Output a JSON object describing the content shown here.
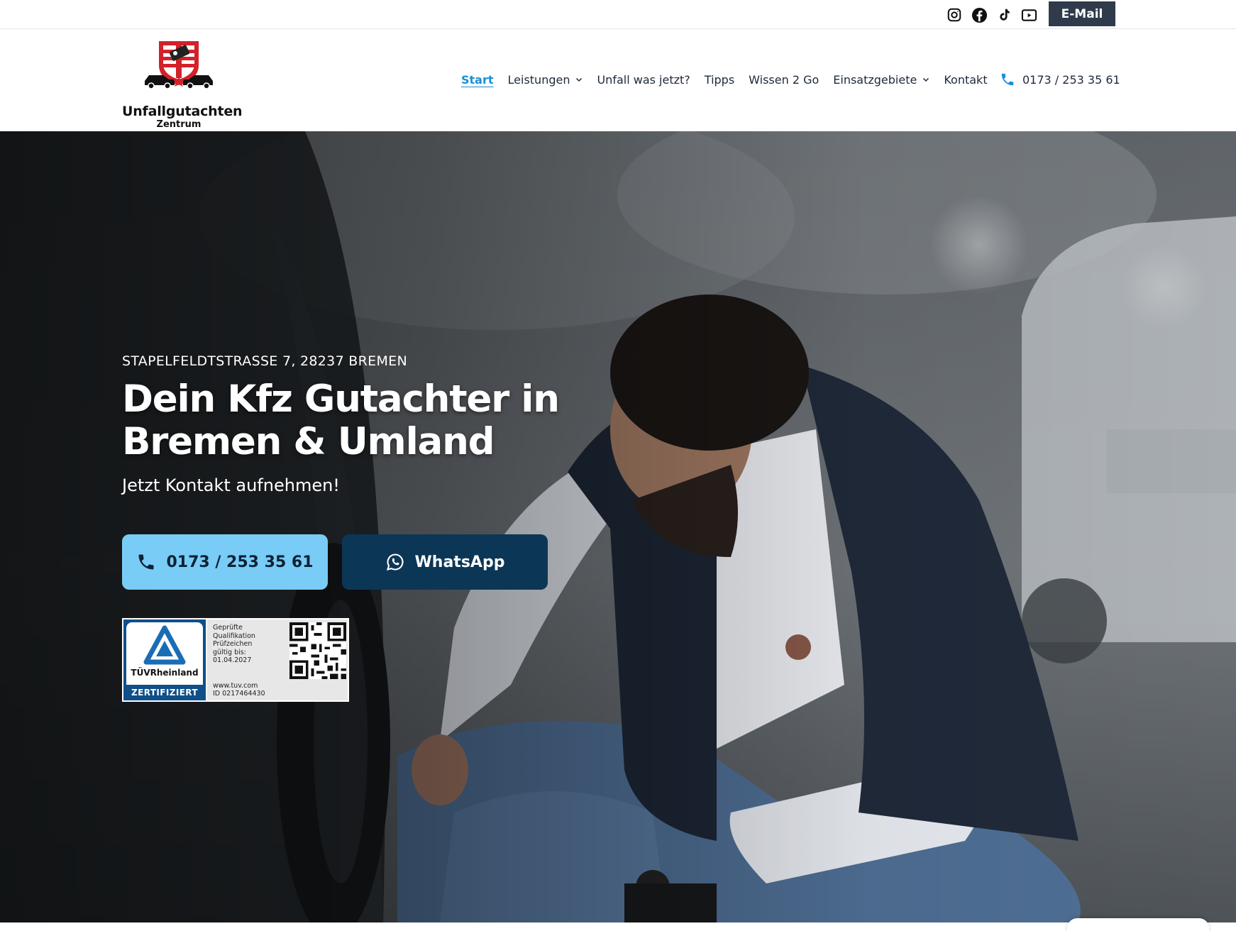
{
  "topbar": {
    "social_icons": [
      "instagram-icon",
      "facebook-icon",
      "tiktok-icon",
      "youtube-icon"
    ],
    "email_label": "E-Mail"
  },
  "logo": {
    "title": "Unfallgutachten",
    "subtitle": "Zentrum"
  },
  "nav": {
    "items": [
      {
        "label": "Start",
        "active": true,
        "dropdown": false
      },
      {
        "label": "Leistungen",
        "active": false,
        "dropdown": true
      },
      {
        "label": "Unfall was jetzt?",
        "active": false,
        "dropdown": false
      },
      {
        "label": "Tipps",
        "active": false,
        "dropdown": false
      },
      {
        "label": "Wissen 2 Go",
        "active": false,
        "dropdown": false
      },
      {
        "label": "Einsatzgebiete",
        "active": false,
        "dropdown": true
      },
      {
        "label": "Kontakt",
        "active": false,
        "dropdown": false
      }
    ],
    "phone": "0173 / 253 35 61"
  },
  "hero": {
    "address": "STAPELFELDTSTRASSE 7, 28237 BREMEN",
    "headline": "Dein Kfz Gutachter in Bremen & Umland",
    "subline": "Jetzt Kontakt aufnehmen!",
    "phone_button": "0173 / 253 35 61",
    "whatsapp_button": "WhatsApp"
  },
  "tuv_badge": {
    "brand": "TÜVRheinland",
    "certified": "ZERTIFIZIERT",
    "line1": "Geprüfte",
    "line2": "Qualifikation",
    "line3": "Prüfzeichen",
    "line4": "gültig bis:",
    "valid_until": "01.04.2027",
    "url": "www.tuv.com",
    "id": "ID  0217464430"
  },
  "colors": {
    "accent": "#1a8fd6",
    "phone_button": "#79ccf6",
    "whatsapp_button": "#0c3656",
    "email_button": "#2f3a4b",
    "tuv_blue": "#0f4f8a"
  }
}
